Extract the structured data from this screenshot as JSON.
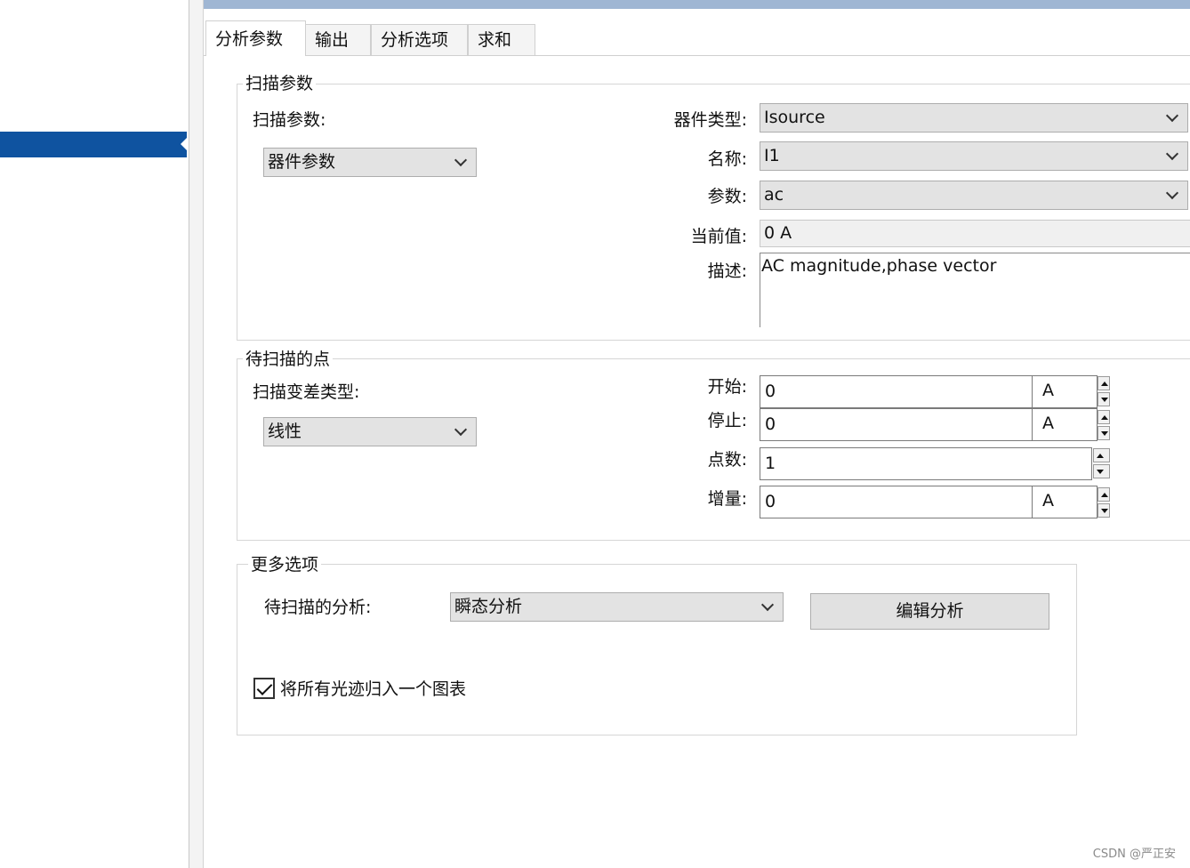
{
  "tabs": [
    "分析参数",
    "输出",
    "分析选项",
    "求和"
  ],
  "sweep_params": {
    "legend": "扫描参数",
    "param_label": "扫描参数:",
    "param_value": "器件参数",
    "device_type_label": "器件类型:",
    "device_type_value": "Isource",
    "name_label": "名称:",
    "name_value": "I1",
    "param2_label": "参数:",
    "param2_value": "ac",
    "current_label": "当前值:",
    "current_value": "0 A",
    "desc_label": "描述:",
    "desc_value": "AC magnitude,phase vector"
  },
  "points": {
    "legend": "待扫描的点",
    "variation_label": "扫描变差类型:",
    "variation_value": "线性",
    "start_label": "开始:",
    "start_value": "0",
    "start_unit": "A",
    "stop_label": "停止:",
    "stop_value": "0",
    "stop_unit": "A",
    "count_label": "点数:",
    "count_value": "1",
    "incr_label": "增量:",
    "incr_value": "0",
    "incr_unit": "A"
  },
  "more": {
    "legend": "更多选项",
    "analysis_label": "待扫描的分析:",
    "analysis_value": "瞬态分析",
    "edit_button": "编辑分析",
    "group_traces_label": "将所有光迹归入一个图表",
    "group_traces_checked": true
  },
  "watermark": "CSDN @严正安",
  "colors": {
    "sidebar_selection": "#0f53a0",
    "top_bar": "#9fb6d3"
  }
}
